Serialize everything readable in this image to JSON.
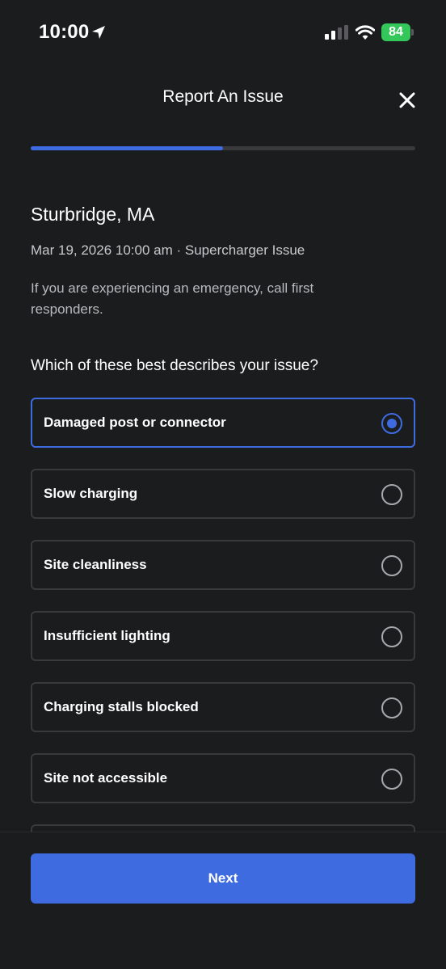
{
  "status_bar": {
    "time": "10:00",
    "battery": "84",
    "battery_color": "#34c759",
    "icons": [
      "location-arrow-icon",
      "cellular-signal-icon",
      "wifi-icon",
      "battery-icon"
    ]
  },
  "header": {
    "title": "Report An Issue",
    "close_icon": "close-icon"
  },
  "progress": {
    "fraction": 0.5,
    "color": "#3e6be0"
  },
  "content": {
    "location": "Sturbridge, MA",
    "meta": "Mar 19, 2026 10:00 am · Supercharger Issue",
    "emergency_note": "If you are experiencing an emergency, call first responders.",
    "question": "Which of these best describes your issue?"
  },
  "options": [
    {
      "label": "Damaged post or connector",
      "selected": true
    },
    {
      "label": "Slow charging",
      "selected": false
    },
    {
      "label": "Site cleanliness",
      "selected": false
    },
    {
      "label": "Insufficient lighting",
      "selected": false
    },
    {
      "label": "Charging stalls blocked",
      "selected": false
    },
    {
      "label": "Site not accessible",
      "selected": false
    },
    {
      "label": "",
      "selected": false
    }
  ],
  "footer": {
    "next_label": "Next"
  },
  "colors": {
    "accent": "#3e6be0",
    "background": "#1b1c1e"
  }
}
